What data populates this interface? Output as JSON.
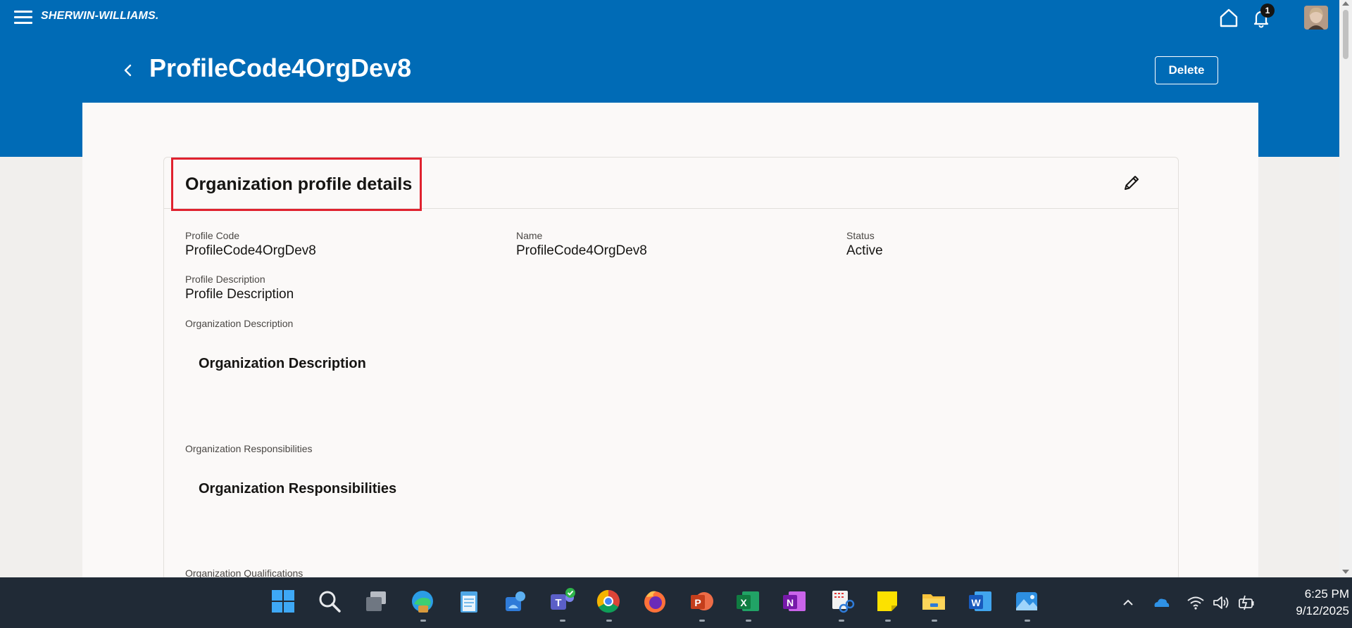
{
  "header": {
    "brand": "SHERWIN-WILLIAMS.",
    "notification_count": "1",
    "page_title": "ProfileCode4OrgDev8",
    "delete_label": "Delete"
  },
  "card": {
    "title": "Organization profile details",
    "fields": {
      "profile_code": {
        "label": "Profile Code",
        "value": "ProfileCode4OrgDev8"
      },
      "name": {
        "label": "Name",
        "value": "ProfileCode4OrgDev8"
      },
      "status": {
        "label": "Status",
        "value": "Active"
      },
      "profile_description": {
        "label": "Profile Description",
        "value": "Profile Description"
      },
      "organization_description": {
        "label": "Organization Description",
        "value": "Organization Description"
      },
      "organization_responsibilities": {
        "label": "Organization Responsibilities",
        "value": "Organization Responsibilities"
      },
      "organization_qualifications": {
        "label": "Organization Qualifications"
      }
    }
  },
  "taskbar": {
    "apps": [
      "windows-start",
      "search",
      "task-view",
      "edge",
      "notepad",
      "people",
      "teams",
      "chrome",
      "firefox",
      "powerpoint",
      "excel",
      "onenote",
      "snipping-tool",
      "sticky-notes",
      "file-explorer",
      "word",
      "photos"
    ],
    "time": "6:25 PM",
    "date": "9/12/2025"
  },
  "colors": {
    "brand_blue": "#006bb6",
    "highlight_red": "#e0222f",
    "taskbar": "#202a36"
  }
}
